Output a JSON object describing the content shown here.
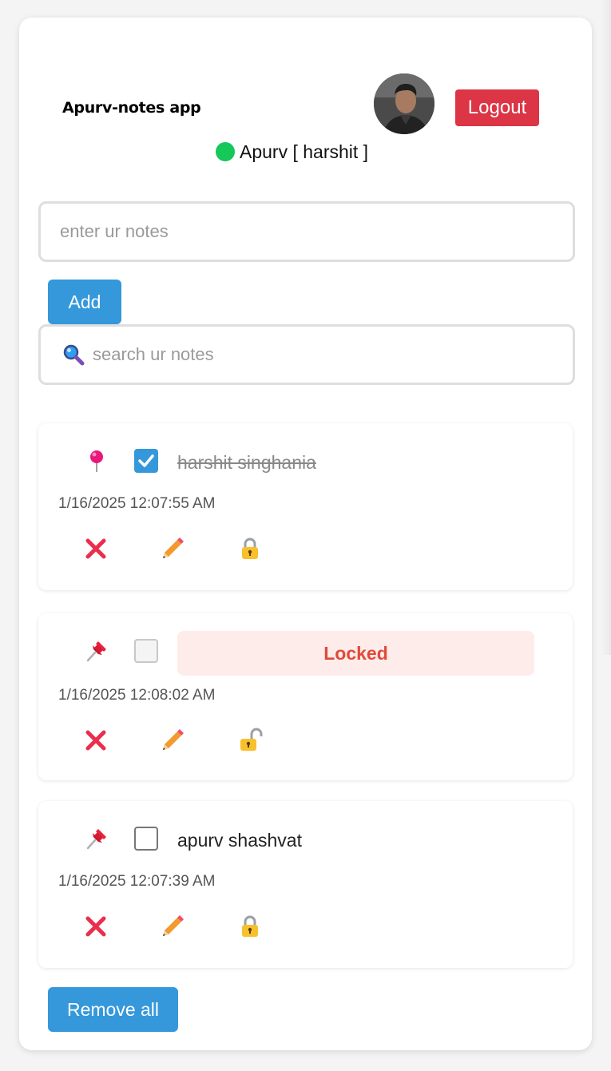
{
  "header": {
    "app_title": "Apurv-notes app",
    "logout_label": "Logout",
    "user_status": "Apurv [ harshit ]"
  },
  "composer": {
    "note_placeholder": "enter ur notes",
    "add_label": "Add"
  },
  "search": {
    "placeholder": "search ur notes",
    "icon": "search-icon"
  },
  "notes": [
    {
      "text": "harshit singhania",
      "date": "1/16/2025 12:07:55 AM",
      "completed": true,
      "pinned": true,
      "locked": false,
      "lock_icon": "lock-closed-icon"
    },
    {
      "text": "Locked",
      "date": "1/16/2025 12:08:02 AM",
      "completed": false,
      "pinned": false,
      "locked": true,
      "lock_icon": "lock-open-icon"
    },
    {
      "text": "apurv shashvat",
      "date": "1/16/2025 12:07:39 AM",
      "completed": false,
      "pinned": false,
      "locked": false,
      "lock_icon": "lock-closed-icon"
    }
  ],
  "footer": {
    "remove_all_label": "Remove all"
  },
  "colors": {
    "accent": "#3498db",
    "danger": "#dc3545",
    "online": "#16c75a",
    "locked_text": "#e04a3a",
    "locked_bg": "#fdecea"
  }
}
